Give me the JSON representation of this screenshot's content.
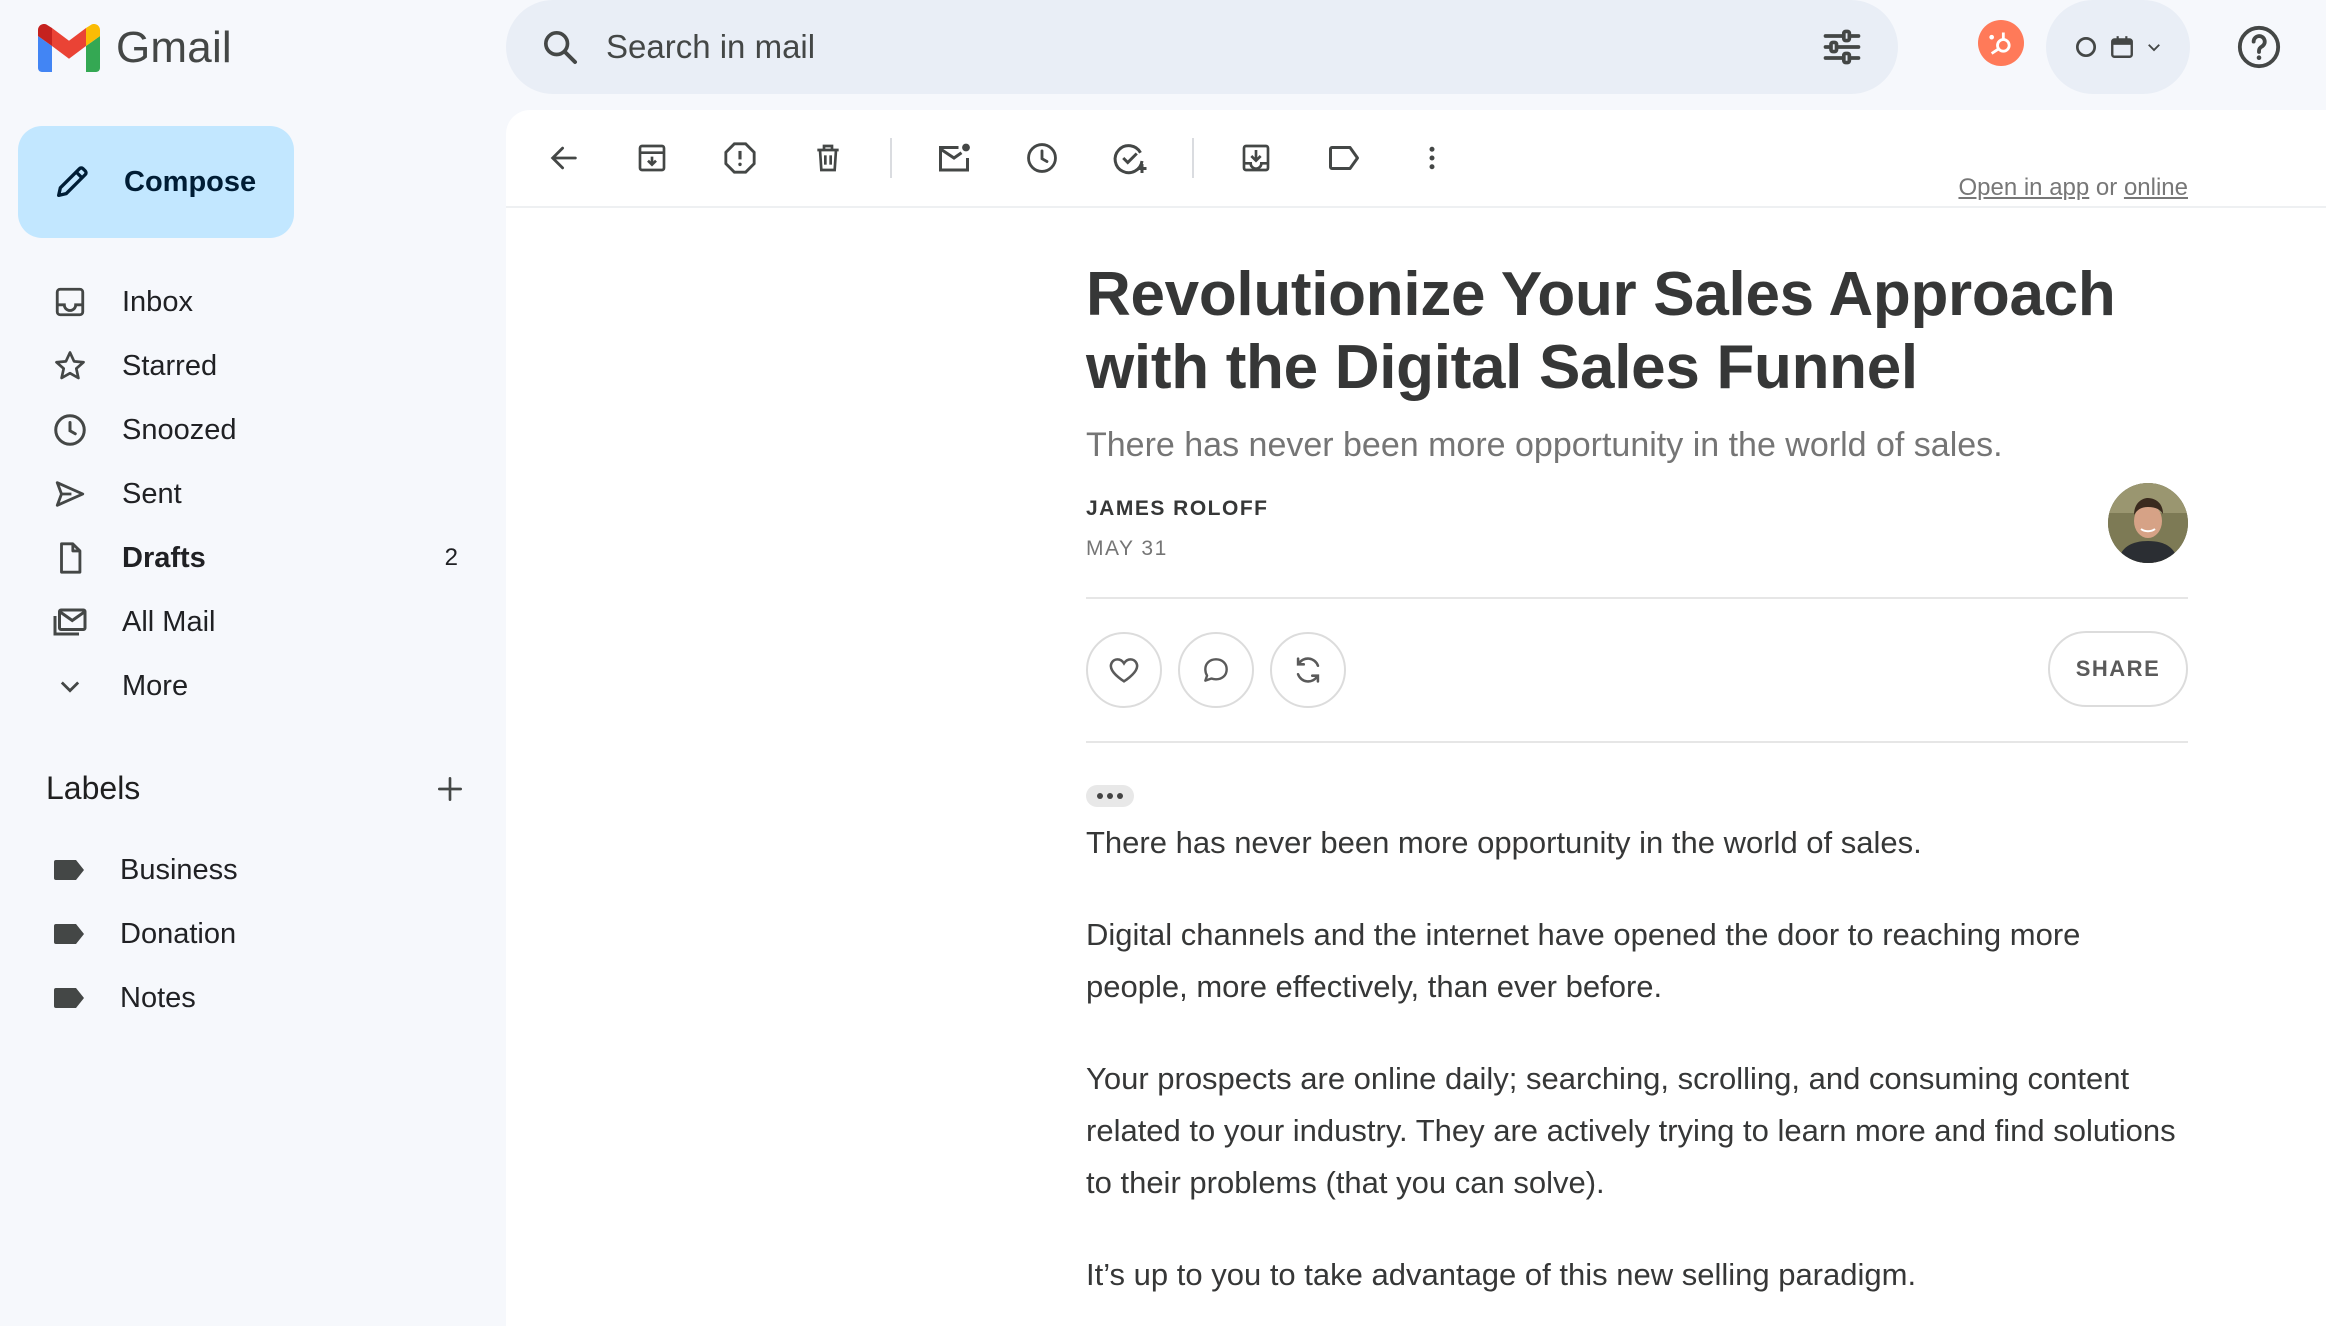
{
  "app": {
    "name": "Gmail"
  },
  "search": {
    "placeholder": "Search in mail"
  },
  "sidebar": {
    "compose_label": "Compose",
    "items": [
      {
        "label": "Inbox",
        "icon": "inbox-icon"
      },
      {
        "label": "Starred",
        "icon": "star-icon"
      },
      {
        "label": "Snoozed",
        "icon": "clock-icon"
      },
      {
        "label": "Sent",
        "icon": "send-icon"
      },
      {
        "label": "Drafts",
        "icon": "draft-icon",
        "count": "2"
      },
      {
        "label": "All Mail",
        "icon": "all-mail-icon"
      },
      {
        "label": "More",
        "icon": "chevron-down-icon"
      }
    ],
    "labels_title": "Labels",
    "labels": [
      {
        "label": "Business"
      },
      {
        "label": "Donation"
      },
      {
        "label": "Notes"
      }
    ]
  },
  "email": {
    "open_in_app": "Open in app",
    "or": "or",
    "online": "online",
    "headline": "Revolutionize Your Sales Approach with the Digital Sales Funnel",
    "subhead": "There has never been more opportunity in the world of sales.",
    "author": "JAMES ROLOFF",
    "date": "MAY 31",
    "share_label": "SHARE",
    "paragraphs": [
      "There has never been more opportunity in the world of sales.",
      "Digital channels and the internet have opened the door to reaching more people, more effectively, than ever before.",
      "Your prospects are online daily; searching, scrolling, and consuming content related to your industry. They are actively trying to learn more and find solutions to their problems (that you can solve).",
      "It’s up to you to take advantage of this new selling paradigm."
    ]
  },
  "colors": {
    "background": "#f6f8fc",
    "search_bg": "#e9eef6",
    "compose_bg": "#c2e7ff",
    "hubspot": "#ff7a59"
  }
}
